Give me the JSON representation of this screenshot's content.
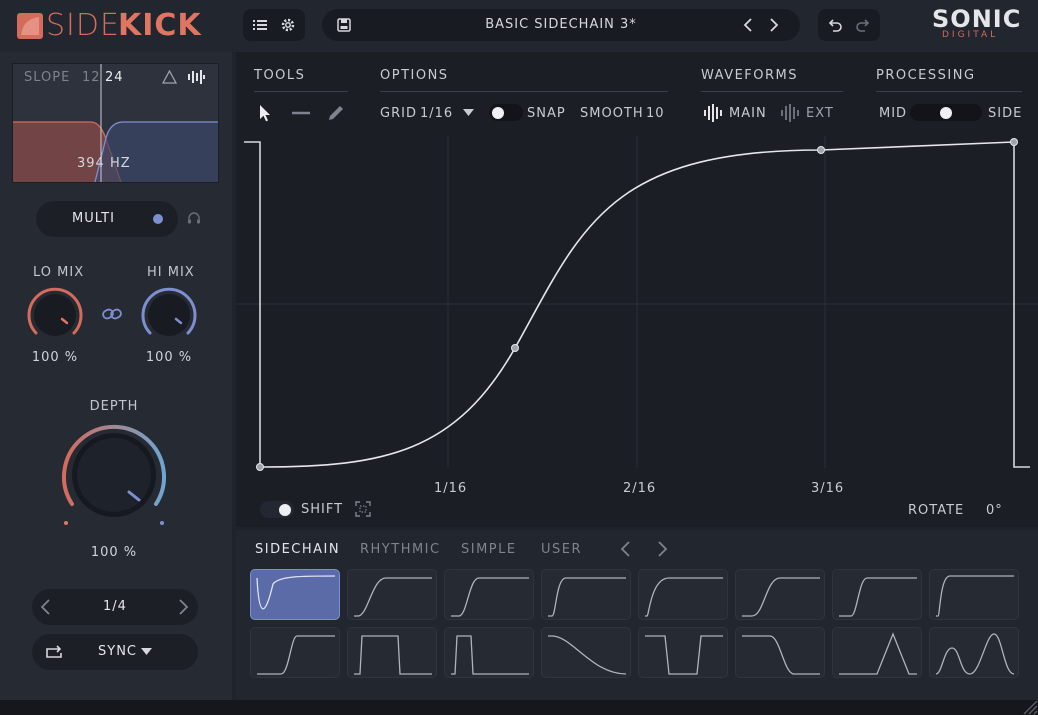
{
  "header": {
    "logo_side": "SIDE",
    "logo_kick": "KICK",
    "preset_name": "BASIC SIDECHAIN 3*",
    "brand_main": "SONIC",
    "brand_sub": "DIGITAL",
    "icons": [
      "list-icon",
      "gear-icon",
      "save-icon",
      "chevron-left-icon",
      "chevron-right-icon",
      "undo-icon",
      "redo-icon"
    ]
  },
  "left": {
    "slope_label": "SLOPE",
    "slope_options": [
      "12",
      "24"
    ],
    "slope_selected": "24",
    "crossover_freq": "394 HZ",
    "mode_label": "MULTI",
    "lo_mix_label": "LO MIX",
    "lo_mix_value": "100 %",
    "hi_mix_label": "HI MIX",
    "hi_mix_value": "100 %",
    "depth_label": "DEPTH",
    "depth_value": "100 %",
    "rate_value": "1/4",
    "sync_label": "SYNC"
  },
  "tools": {
    "section_label": "TOOLS",
    "icons": [
      "pointer-icon",
      "line-icon",
      "pencil-icon"
    ]
  },
  "options": {
    "section_label": "OPTIONS",
    "grid_label": "GRID",
    "grid_value": "1/16",
    "snap_label": "SNAP",
    "snap_on": false,
    "smooth_label": "SMOOTH",
    "smooth_value": "10"
  },
  "waveforms": {
    "section_label": "WAVEFORMS",
    "main_label": "MAIN",
    "ext_label": "EXT"
  },
  "processing": {
    "section_label": "PROCESSING",
    "mid_label": "MID",
    "side_label": "SIDE",
    "balance": 0.5
  },
  "graph": {
    "grid_labels": [
      "1/16",
      "2/16",
      "3/16"
    ],
    "shift_label": "SHIFT",
    "rotate_label": "ROTATE",
    "rotate_value": "0°"
  },
  "presets": {
    "tabs": [
      "SIDECHAIN",
      "RHYTHMIC",
      "SIMPLE",
      "USER"
    ],
    "active_tab": "SIDECHAIN",
    "selected_index": 0,
    "count": 16
  },
  "colors": {
    "accent_red": "#e07561",
    "accent_blue": "#7d8fd0",
    "background": "#1b1e24"
  }
}
